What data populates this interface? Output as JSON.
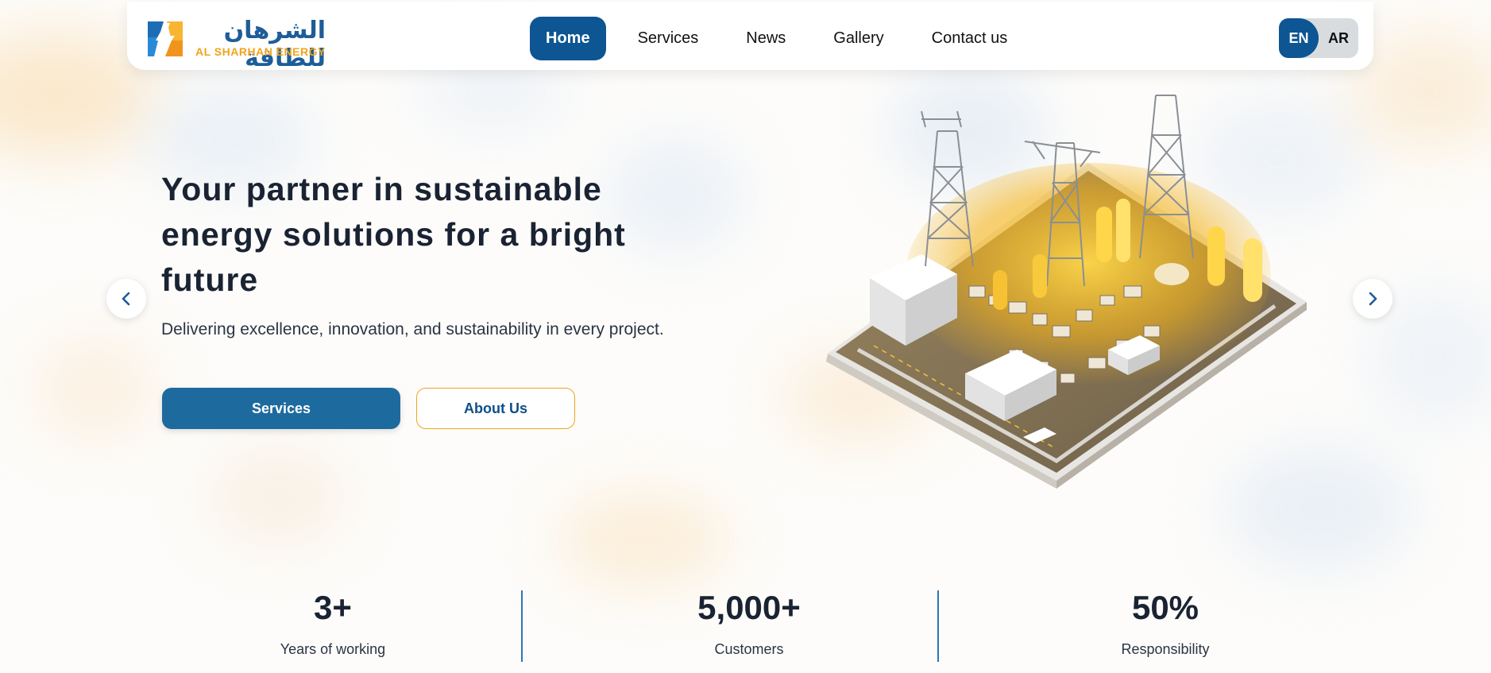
{
  "brand": {
    "name_ar": "الشرهان للطاقة",
    "name_en": "AL SHARHAN ENERGY",
    "logo_icon": "lightning-bolt-logo",
    "colors": {
      "blue": "#0d5593",
      "orange": "#f0a41c"
    }
  },
  "nav": {
    "items": [
      {
        "label": "Home",
        "active": true
      },
      {
        "label": "Services",
        "active": false
      },
      {
        "label": "News",
        "active": false
      },
      {
        "label": "Gallery",
        "active": false
      },
      {
        "label": "Contact us",
        "active": false
      }
    ]
  },
  "language": {
    "en": "EN",
    "ar": "AR",
    "selected": "EN"
  },
  "hero": {
    "title": "Your partner in sustainable energy solutions for a bright future",
    "subtitle": "Delivering excellence, innovation, and sustainability in every project.",
    "primary_button": "Services",
    "secondary_button": "About Us",
    "prev_icon": "chevron-left-icon",
    "next_icon": "chevron-right-icon",
    "image": "isometric-energy-plant-illustration"
  },
  "stats": [
    {
      "value": "3+",
      "label": "Years of working"
    },
    {
      "value": "5,000+",
      "label": "Customers"
    },
    {
      "value": "50%",
      "label": "Responsibility"
    }
  ]
}
